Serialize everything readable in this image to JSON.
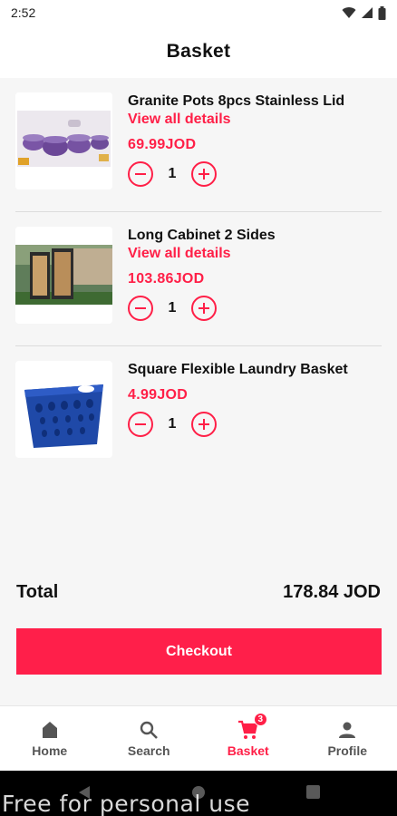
{
  "status": {
    "time": "2:52"
  },
  "header": {
    "title": "Basket"
  },
  "items": [
    {
      "name": "Granite Pots 8pcs Stainless Lid",
      "details_label": "View all details",
      "price": "69.99JOD",
      "quantity": "1"
    },
    {
      "name": "Long Cabinet 2 Sides",
      "details_label": "View all details",
      "price": "103.86JOD",
      "quantity": "1"
    },
    {
      "name": "Square Flexible Laundry Basket",
      "details_label": "",
      "price": "4.99JOD",
      "quantity": "1"
    }
  ],
  "summary": {
    "total_label": "Total",
    "total_value": "178.84 JOD"
  },
  "checkout_label": "Checkout",
  "nav": {
    "items": [
      {
        "label": "Home",
        "icon": "home-icon"
      },
      {
        "label": "Search",
        "icon": "search-icon"
      },
      {
        "label": "Basket",
        "icon": "cart-icon",
        "badge": "3"
      },
      {
        "label": "Profile",
        "icon": "person-icon"
      }
    ],
    "active": "Basket"
  },
  "watermark": "Free for personal use",
  "colors": {
    "accent": "#ff1f47",
    "checkout": "#ff1f4a",
    "background": "#f6f6f6"
  }
}
